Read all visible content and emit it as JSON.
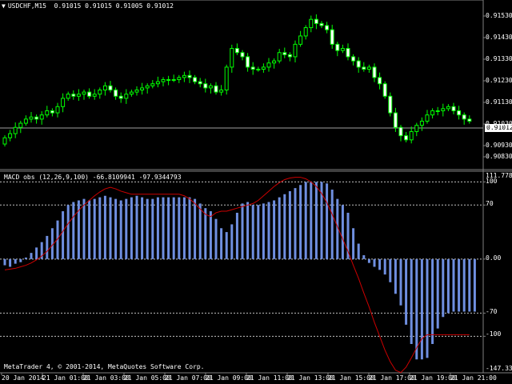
{
  "title": {
    "symbol": "USDCHF,M15",
    "ohlc": "0.91015 0.91015 0.91005 0.91012",
    "arrow_icon": "triangle-down-icon"
  },
  "price_axis": [
    "0.91530",
    "0.91430",
    "0.91330",
    "0.91230",
    "0.91130",
    "0.91030",
    "0.90930",
    "0.90830"
  ],
  "current_price": "0.91012",
  "macd": {
    "title": "MACD obs (12,26,9,100) -66.8109941 -97.9344793",
    "axis": [
      "111.7780",
      "100",
      "70",
      "0.00",
      "-70",
      "-100",
      "-147.3338"
    ]
  },
  "time_axis": [
    "20 Jan 2014",
    "21 Jan 01:00",
    "21 Jan 03:00",
    "21 Jan 05:00",
    "21 Jan 07:00",
    "21 Jan 09:00",
    "21 Jan 11:00",
    "21 Jan 13:00",
    "21 Jan 15:00",
    "21 Jan 17:00",
    "21 Jan 19:00",
    "21 Jan 21:00"
  ],
  "copyright": "MetaTrader 4, © 2001-2014, MetaQuotes Software Corp.",
  "colors": {
    "bull": "#00ff00",
    "bear": "#ffffff",
    "hist": "#6f8fe0",
    "signal": "#cc0000",
    "grid": "#c0c0c0"
  },
  "chart_data": {
    "type": "candlestick",
    "candles_close": [
      0.9093,
      0.9095,
      0.9098,
      0.91,
      0.9102,
      0.9103,
      0.9102,
      0.9104,
      0.9106,
      0.9105,
      0.9108,
      0.9112,
      0.9114,
      0.9113,
      0.9114,
      0.9115,
      0.9113,
      0.9114,
      0.9116,
      0.9118,
      0.9116,
      0.9113,
      0.9112,
      0.9114,
      0.9115,
      0.9116,
      0.9117,
      0.9118,
      0.9119,
      0.912,
      0.9121,
      0.9121,
      0.9121,
      0.9122,
      0.9123,
      0.9122,
      0.912,
      0.9119,
      0.9117,
      0.9118,
      0.9115,
      0.9116,
      0.9127,
      0.9136,
      0.9134,
      0.9132,
      0.9127,
      0.9126,
      0.9126,
      0.9127,
      0.9129,
      0.913,
      0.9134,
      0.9133,
      0.9132,
      0.9138,
      0.9142,
      0.9146,
      0.915,
      0.9148,
      0.9147,
      0.9145,
      0.9138,
      0.9135,
      0.9136,
      0.9132,
      0.913,
      0.9127,
      0.9126,
      0.9127,
      0.9122,
      0.9119,
      0.9113,
      0.9105,
      0.9098,
      0.9094,
      0.9092,
      0.9096,
      0.9099,
      0.9101,
      0.9104,
      0.9106,
      0.9106,
      0.9107,
      0.9108,
      0.9106,
      0.9104,
      0.9102,
      0.9101
    ],
    "macd_hist": [
      -8,
      -10,
      -6,
      -4,
      2,
      8,
      15,
      22,
      30,
      40,
      50,
      62,
      70,
      74,
      76,
      78,
      76,
      78,
      80,
      82,
      80,
      78,
      76,
      78,
      80,
      82,
      80,
      78,
      78,
      80,
      80,
      80,
      80,
      80,
      80,
      80,
      78,
      72,
      66,
      62,
      52,
      40,
      35,
      45,
      60,
      72,
      74,
      70,
      70,
      72,
      74,
      76,
      80,
      84,
      88,
      92,
      96,
      100,
      100,
      100,
      100,
      98,
      90,
      78,
      70,
      60,
      40,
      20,
      5,
      -5,
      -10,
      -14,
      -20,
      -30,
      -45,
      -60,
      -85,
      -110,
      -130,
      -130,
      -128,
      -110,
      -90,
      -75,
      -70,
      -68,
      -68,
      -68,
      -68,
      -68
    ],
    "macd_signal": [
      -14,
      -13,
      -12,
      -10,
      -8,
      -5,
      -1,
      4,
      10,
      18,
      26,
      36,
      46,
      55,
      63,
      70,
      76,
      82,
      87,
      91,
      93,
      91,
      88,
      86,
      84,
      84,
      84,
      84,
      84,
      84,
      84,
      84,
      84,
      84,
      82,
      78,
      72,
      65,
      58,
      55,
      60,
      62,
      62,
      64,
      66,
      68,
      70,
      72,
      76,
      82,
      88,
      94,
      99,
      103,
      105,
      106,
      106,
      104,
      100,
      94,
      85,
      73,
      58,
      42,
      26,
      10,
      -8,
      -25,
      -44,
      -62,
      -82,
      -100,
      -118,
      -133,
      -144,
      -147,
      -140,
      -128,
      -115,
      -103,
      -98,
      -98,
      -98,
      -98,
      -98,
      -98,
      -98,
      -98,
      -98
    ],
    "ylim_price": [
      0.908,
      0.9157
    ],
    "ylim_macd": [
      -147.3338,
      111.778
    ]
  }
}
